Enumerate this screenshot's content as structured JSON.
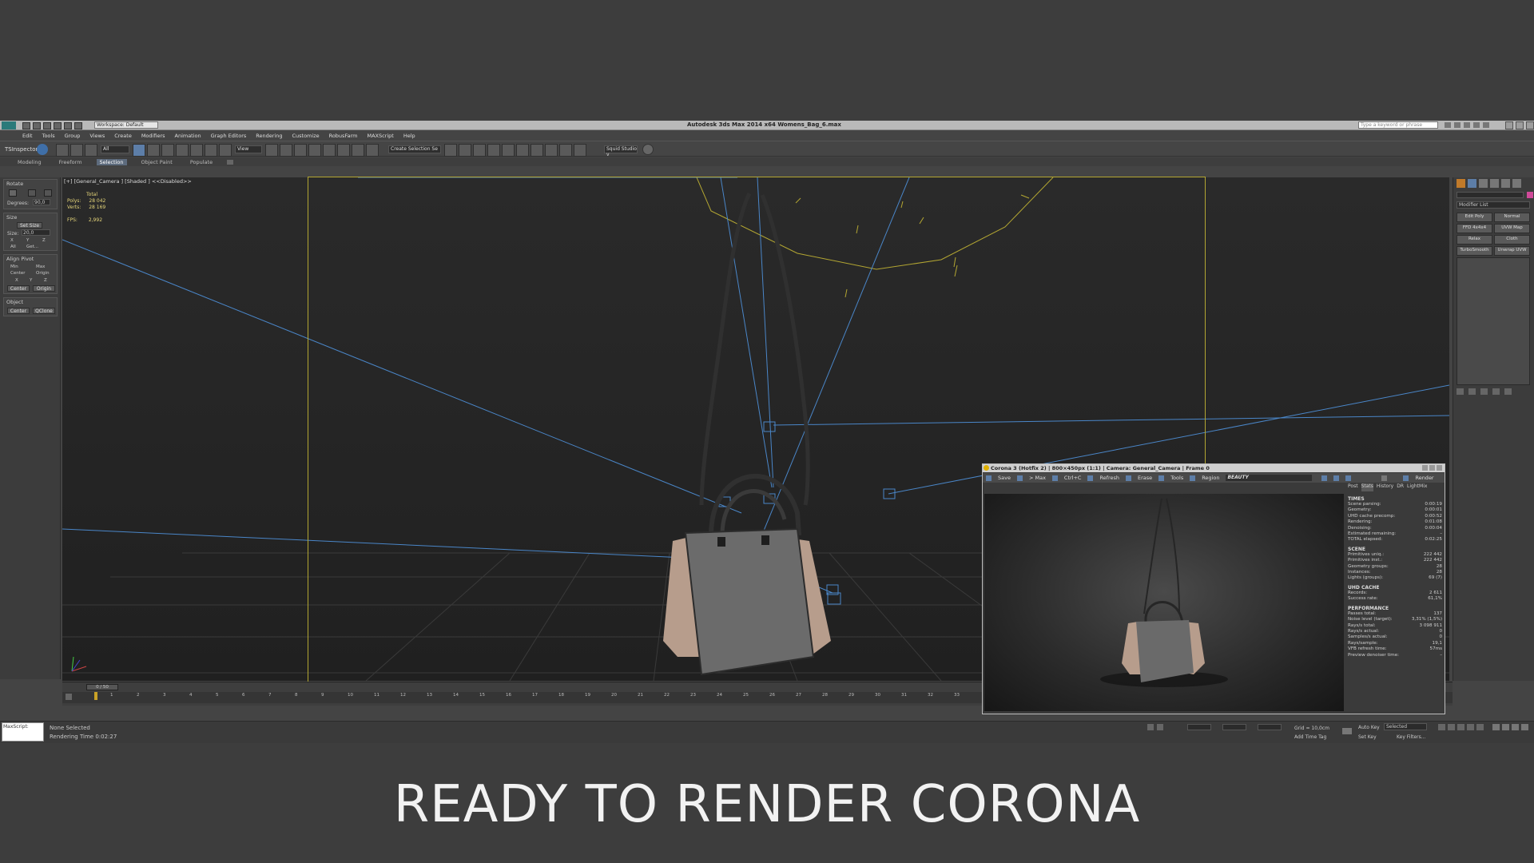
{
  "app": {
    "title": "Autodesk 3ds Max  2014 x64     Womens_Bag_6.max",
    "workspace": "Workspace: Default",
    "search_placeholder": "Type a keyword or phrase"
  },
  "menu": [
    "Edit",
    "Tools",
    "Group",
    "Views",
    "Create",
    "Modifiers",
    "Animation",
    "Graph Editors",
    "Rendering",
    "Customize",
    "RobusFarm",
    "MAXScript",
    "Help"
  ],
  "toolbar": {
    "left_label": "TSInspector",
    "filter": "All",
    "view": "View",
    "selection_set": "Create Selection Se",
    "squid": "Squid Studio v"
  },
  "ribbon": {
    "tabs": [
      "Modeling",
      "Freeform",
      "Selection",
      "Object Paint",
      "Populate"
    ],
    "selected": "Selection"
  },
  "left_panel": {
    "rotate": {
      "title": "Rotate",
      "degrees_label": "Degrees:",
      "degrees_value": "90,0"
    },
    "size": {
      "title": "Size",
      "set_size": "Set Size",
      "size_label": "Size:",
      "size_value": "20,0",
      "axes": [
        "X",
        "Y",
        "Z",
        "All"
      ],
      "get": "Get..."
    },
    "align_pivot": {
      "title": "Align Pivot",
      "options": [
        "Min",
        "Max",
        "Center",
        "Origin"
      ],
      "axes": [
        "X",
        "Y",
        "Z"
      ],
      "center": "Center",
      "origin": "Origin"
    },
    "object": {
      "title": "Object",
      "center": "Center",
      "qclone": "QClone"
    }
  },
  "viewport": {
    "label": "[+] [General_Camera ] [Shaded ]  <<Disabled>>",
    "stats": {
      "total": "Total",
      "polys_label": "Polys:",
      "polys": "28 042",
      "verts_label": "Verts:",
      "verts": "28 169",
      "fps_label": "FPS:",
      "fps": "2,992"
    }
  },
  "right_panel": {
    "modifier_list": "Modifier List",
    "buttons": [
      "Edit Poly",
      "Normal",
      "FFD 4x4x4",
      "UVW Map",
      "Relax",
      "Cloth",
      "TurboSmooth",
      "Unwrap UVW"
    ]
  },
  "timeline": {
    "range": "0 / 50",
    "ticks": [
      "1",
      "2",
      "3",
      "4",
      "5",
      "6",
      "7",
      "8",
      "9",
      "10",
      "11",
      "12",
      "13",
      "14",
      "15",
      "16",
      "17",
      "18",
      "19",
      "20",
      "21",
      "22",
      "23",
      "24",
      "25",
      "26",
      "27",
      "28",
      "29",
      "30",
      "31",
      "32",
      "33"
    ]
  },
  "status": {
    "maxscript": "MaxScript: ",
    "selection": "None Selected",
    "render_time": "Rendering Time  0:02:27",
    "grid": "Grid = 10,0cm",
    "add_time_tag": "Add Time Tag",
    "auto_key": "Auto Key",
    "selected": "Selected",
    "set_key": "Set Key",
    "key_filters": "Key Filters..."
  },
  "vfb": {
    "title": "Corona 3 (Hotfix 2)  | 800×450px (1:1) | Camera: General_Camera | Frame 0",
    "tools": [
      "Save",
      "> Max",
      "Ctrl+C",
      "Refresh",
      "Erase",
      "Tools",
      "Region"
    ],
    "pass": "BEAUTY",
    "render_button": "Render",
    "tabs": [
      "Post",
      "Stats",
      "History",
      "DR",
      "LightMix"
    ],
    "selected_tab": "Stats",
    "sections": [
      {
        "title": "TIMES",
        "rows": [
          [
            "Scene parsing:",
            "0:00:19"
          ],
          [
            "Geometry:",
            "0:00:01"
          ],
          [
            "UHD cache precomp:",
            "0:00:52"
          ],
          [
            "Rendering:",
            "0:01:08"
          ],
          [
            "Denoising:",
            "0:00:04"
          ],
          [
            "Estimated remaining:",
            "–"
          ],
          [
            "TOTAL elapsed:",
            "0:02:25"
          ]
        ]
      },
      {
        "title": "SCENE",
        "rows": [
          [
            "Primitives uniq.:",
            "222 442"
          ],
          [
            "Primitives inst.:",
            "222 442"
          ],
          [
            "Geometry groups:",
            "28"
          ],
          [
            "Instances:",
            "28"
          ],
          [
            "Lights (groups):",
            "69 (7)"
          ]
        ]
      },
      {
        "title": "UHD CACHE",
        "rows": [
          [
            "Records:",
            "2 611"
          ],
          [
            "Success rate:",
            "61,1%"
          ]
        ]
      },
      {
        "title": "PERFORMANCE",
        "rows": [
          [
            "Passes total:",
            "137"
          ],
          [
            "Noise level (target):",
            "3,31% (1,5%)"
          ],
          [
            "Rays/s total:",
            "3 098 911"
          ],
          [
            "Rays/s actual:",
            "0"
          ],
          [
            "Samples/s actual:",
            "0"
          ],
          [
            "Rays/sample:",
            "19,1"
          ],
          [
            "VFB refresh time:",
            "57ms"
          ],
          [
            "Preview denoiser time:",
            "–"
          ]
        ]
      }
    ]
  },
  "caption": "READY TO RENDER  CORONA",
  "colors": {
    "accent": "#5d6b7d",
    "camera_frame": "#b3a632",
    "light_lines": "#4a86c8"
  }
}
